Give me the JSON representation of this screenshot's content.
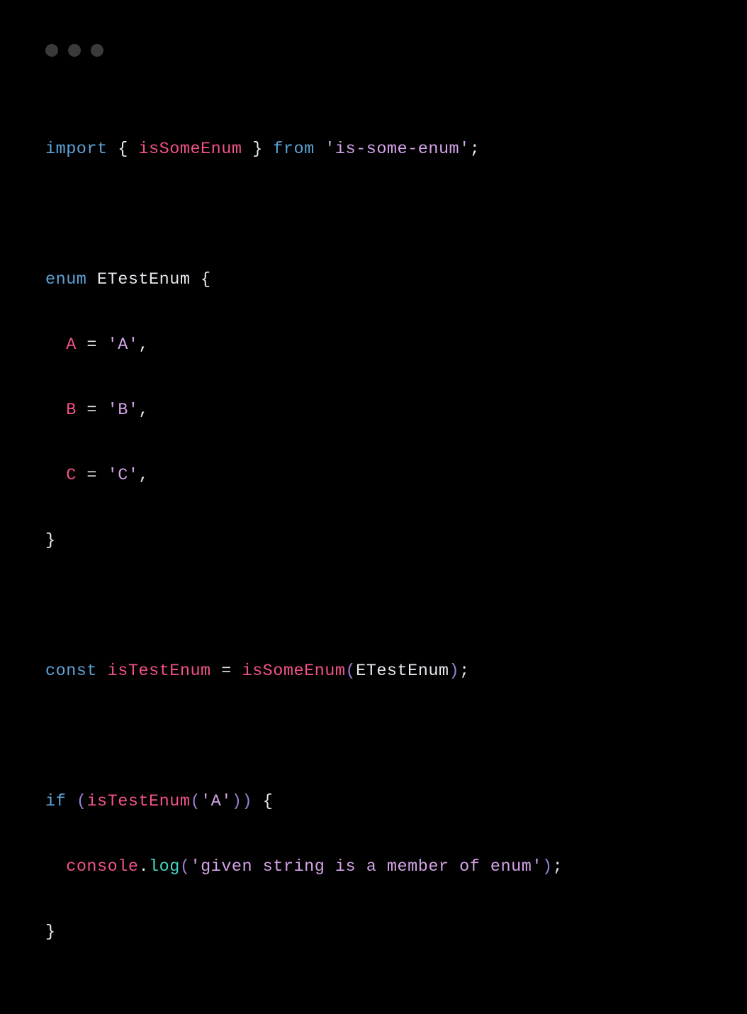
{
  "code": {
    "line1": {
      "import": "import",
      "brace_open": " { ",
      "func": "isSomeEnum",
      "brace_close": " } ",
      "from": "from",
      "space": " ",
      "module": "'is-some-enum'",
      "semi": ";"
    },
    "line3": {
      "enum": "enum",
      "space": " ",
      "name": "ETestEnum",
      "brace": " {"
    },
    "line4": {
      "indent": "  ",
      "key": "A",
      "eq": " = ",
      "val": "'A'",
      "comma": ","
    },
    "line5": {
      "indent": "  ",
      "key": "B",
      "eq": " = ",
      "val": "'B'",
      "comma": ","
    },
    "line6": {
      "indent": "  ",
      "key": "C",
      "eq": " = ",
      "val": "'C'",
      "comma": ","
    },
    "line7": {
      "brace": "}"
    },
    "line9": {
      "const": "const",
      "space": " ",
      "var": "isTestEnum",
      "eq": " = ",
      "func": "isSomeEnum",
      "paren_open": "(",
      "arg": "ETestEnum",
      "paren_close": ")",
      "semi": ";"
    },
    "line11": {
      "if": "if",
      "space": " ",
      "paren_open": "(",
      "func": "isTestEnum",
      "paren_open2": "(",
      "arg": "'A'",
      "paren_close2": ")",
      "paren_close": ")",
      "brace": " {"
    },
    "line12": {
      "indent": "  ",
      "obj": "console",
      "dot": ".",
      "method": "log",
      "paren_open": "(",
      "str": "'given string is a member of enum'",
      "paren_close": ")",
      "semi": ";"
    },
    "line13": {
      "brace": "}"
    }
  }
}
